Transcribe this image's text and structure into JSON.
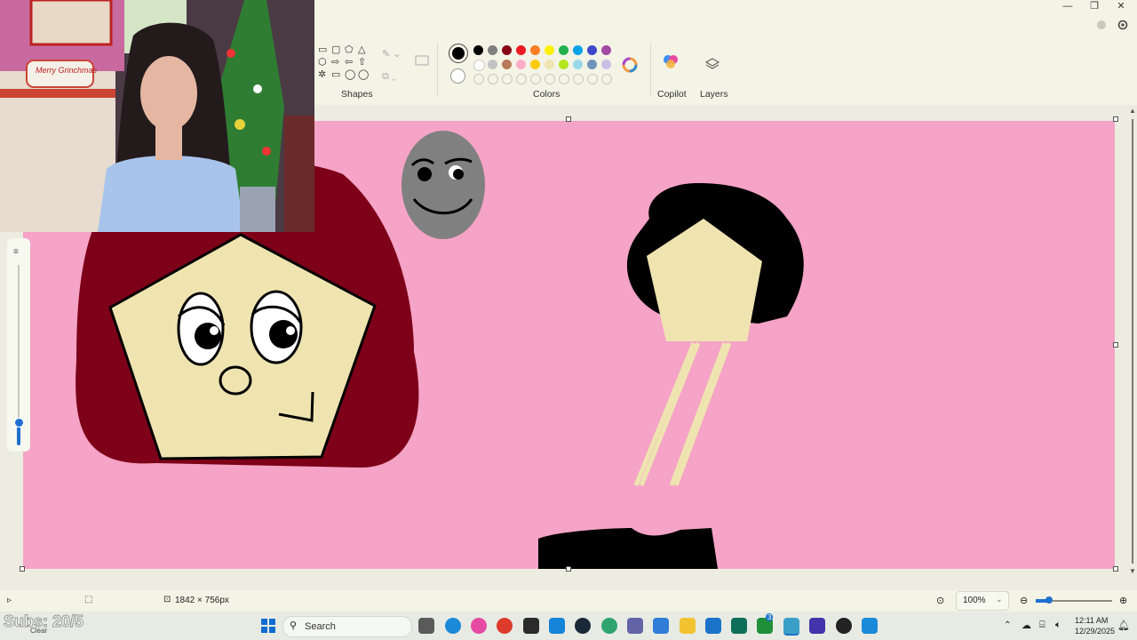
{
  "window": {
    "minimize": "—",
    "restore": "❐",
    "close": "✕"
  },
  "ribbon": {
    "shapes_label": "Shapes",
    "colors_label": "Colors",
    "copilot_label": "Copilot",
    "layers_label": "Layers",
    "palette_row1": [
      "#000000",
      "#7f7f7f",
      "#880015",
      "#ed1c24",
      "#ff7f27",
      "#fff200",
      "#22b14c",
      "#00a2e8",
      "#3f48cc",
      "#a349a4"
    ],
    "palette_row2": [
      "#ffffff",
      "#c3c3c3",
      "#b97a57",
      "#ffaec9",
      "#ffc90e",
      "#efe4b0",
      "#b5e61d",
      "#99d9ea",
      "#7092be",
      "#c8bfe7"
    ],
    "primary_color": "#000000",
    "secondary_color": "#ffffff"
  },
  "canvas": {
    "background": "#f5a3c6"
  },
  "statusbar": {
    "dimensions": "1842 × 756px",
    "zoom": "100%"
  },
  "overlay": {
    "subs": "Subs: 20/5",
    "weather": "Clear"
  },
  "taskbar": {
    "search_placeholder": "Search",
    "time": "12:11 AM",
    "date": "12/29/2025",
    "badge_count": "3"
  },
  "webcam": {
    "sign_text": "Merry Grinchmas"
  }
}
